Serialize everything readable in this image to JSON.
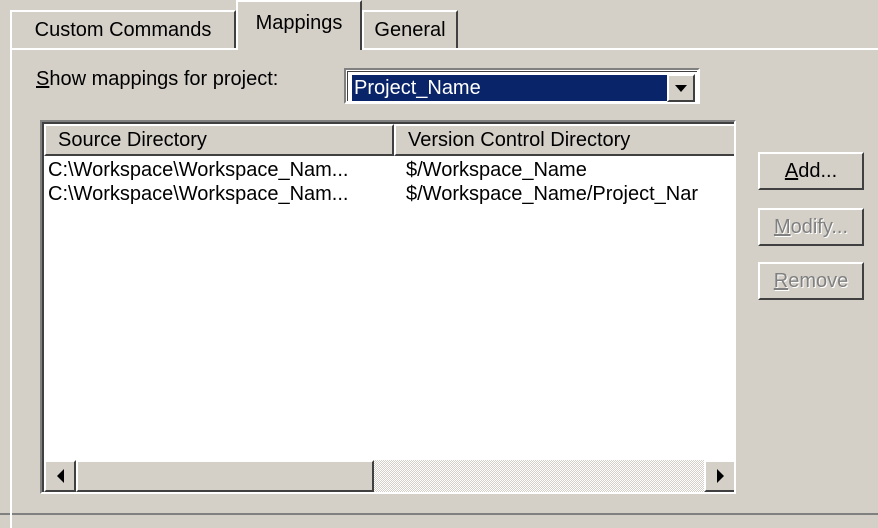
{
  "tabs": [
    {
      "label": "Custom Commands"
    },
    {
      "label": "Mappings",
      "selected": true
    },
    {
      "label": "General"
    }
  ],
  "project_selector": {
    "label_prefix": "S",
    "label_rest": "how mappings for project:",
    "selected_value": "Project_Name"
  },
  "list": {
    "columns": [
      "Source Directory",
      "Version Control Directory"
    ],
    "rows": [
      {
        "source": "C:\\Workspace\\Workspace_Nam...",
        "vcd": "$/Workspace_Name"
      },
      {
        "source": "C:\\Workspace\\Workspace_Nam...",
        "vcd": "$/Workspace_Name/Project_Nar"
      }
    ]
  },
  "buttons": {
    "add": {
      "mnemonic": "A",
      "rest": "dd...",
      "enabled": true
    },
    "modify": {
      "mnemonic": "M",
      "rest": "odify...",
      "enabled": false
    },
    "remove": {
      "mnemonic": "R",
      "rest": "emove",
      "enabled": false
    }
  },
  "colors": {
    "face": "#d4d0c8",
    "selection": "#0a246a",
    "disabled_text": "#808080"
  }
}
